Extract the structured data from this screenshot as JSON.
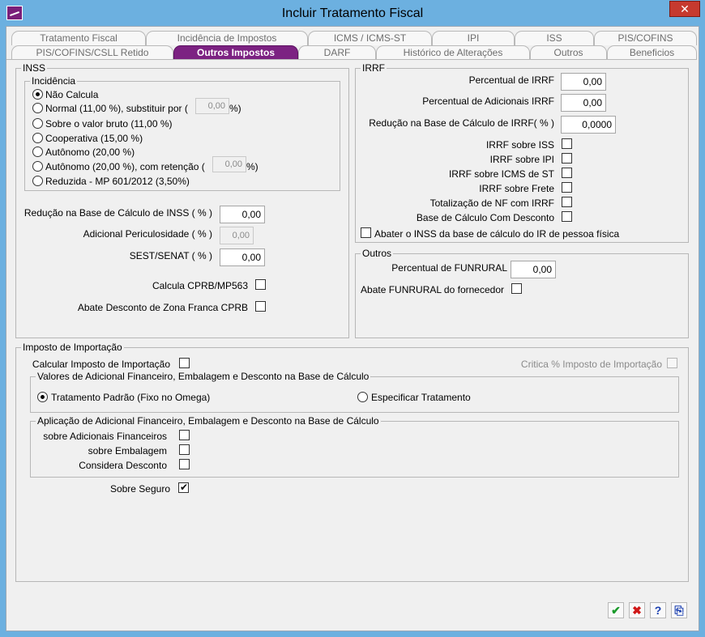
{
  "window": {
    "title": "Incluir Tratamento Fiscal",
    "close": "✕"
  },
  "tabs_row1": [
    "Tratamento Fiscal",
    "Incidência de Impostos",
    "ICMS / ICMS-ST",
    "IPI",
    "ISS",
    "PIS/COFINS"
  ],
  "tabs_row2": [
    "PIS/COFINS/CSLL Retido",
    "Outros Impostos",
    "DARF",
    "Histórico de Alterações",
    "Outros",
    "Beneficios"
  ],
  "active_tab": "Outros Impostos",
  "inss": {
    "title": "INSS",
    "incidencia_title": "Incidência",
    "options": {
      "nao_calcula": "Não Calcula",
      "normal": "Normal (11,00 %), substituir por (",
      "normal_value": "0,00",
      "normal_suffix": "%)",
      "bruto": "Sobre o valor bruto (11,00 %)",
      "cooperativa": "Cooperativa (15,00 %)",
      "autonomo": "Autônomo (20,00 %)",
      "autonomo_ret": "Autônomo (20,00 %), com retenção (",
      "autonomo_ret_value": "0,00",
      "autonomo_ret_suffix": "%)",
      "reduzida": "Reduzida - MP 601/2012 (3,50%)"
    },
    "selected": "Não Calcula",
    "reducao_label": "Redução na Base de Cálculo de INSS ( % )",
    "reducao_value": "0,00",
    "adicional_label": "Adicional Periculosidade ( % )",
    "adicional_value": "0,00",
    "sest_label": "SEST/SENAT ( % )",
    "sest_value": "0,00",
    "cprb_label": "Calcula CPRB/MP563",
    "zona_franca_label": "Abate Desconto de Zona Franca CPRB"
  },
  "irrf": {
    "title": "IRRF",
    "percentual_label": "Percentual de IRRF",
    "percentual_value": "0,00",
    "adicionais_label": "Percentual de Adicionais IRRF",
    "adicionais_value": "0,00",
    "reducao_label": "Redução na Base de Cálculo de IRRF( % )",
    "reducao_value": "0,0000",
    "sobre_iss": "IRRF sobre ISS",
    "sobre_ipi": "IRRF sobre IPI",
    "sobre_icms_st": "IRRF sobre ICMS de ST",
    "sobre_frete": "IRRF sobre Frete",
    "totalizacao": "Totalização de NF com IRRF",
    "base_desconto": "Base de Cálculo Com Desconto",
    "abater_inss": "Abater o INSS da base de cálculo do IR de pessoa física"
  },
  "outros": {
    "title": "Outros",
    "funrural_label": "Percentual de FUNRURAL",
    "funrural_value": "0,00",
    "abate_funrural_label": "Abate FUNRURAL do fornecedor"
  },
  "importacao": {
    "title": "Imposto de Importação",
    "calcular_label": "Calcular Imposto de Importação",
    "critica_label": "Critica % Imposto de Importação",
    "valores_title": "Valores de Adicional Financeiro, Embalagem e Desconto na Base de Cálculo",
    "tratamento_padrao": "Tratamento Padrão (Fixo no Omega)",
    "especificar": "Especificar Tratamento",
    "aplicacao_title": "Aplicação de Adicional Financeiro, Embalagem e Desconto na Base de Cálculo",
    "adicionais_financeiros": "sobre Adicionais Financeiros",
    "embalagem": "sobre Embalagem",
    "considera_desconto": "Considera Desconto",
    "sobre_seguro": "Sobre Seguro",
    "sobre_seguro_checked": true
  },
  "toolbar": {
    "ok": "✔",
    "cancel": "✖",
    "help": "?",
    "exit": "⎘"
  },
  "colors": {
    "active_tab": "#7c2282",
    "window_frame": "#6cb0e0",
    "close_button": "#c63a2f",
    "ok_green": "#1a9a2a",
    "cancel_red": "#d01818",
    "help_blue": "#1a3fb0"
  }
}
